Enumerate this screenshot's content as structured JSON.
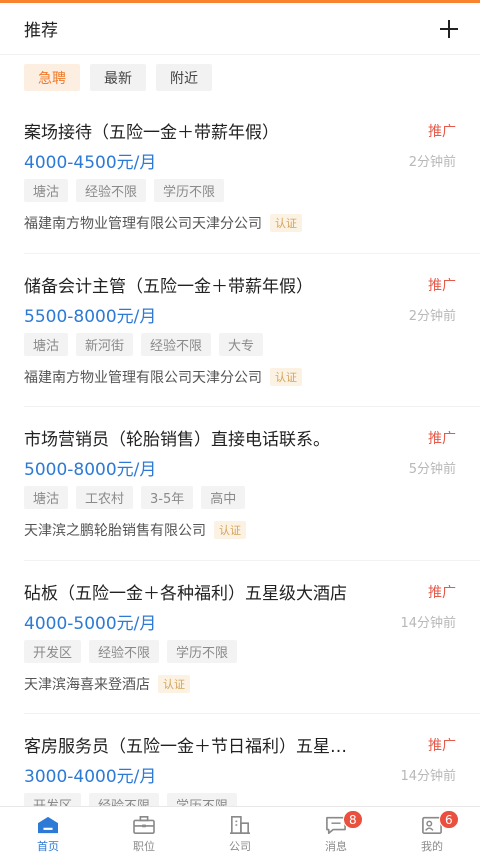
{
  "header": {
    "title": "推荐"
  },
  "filters": [
    {
      "label": "急聘",
      "active": true
    },
    {
      "label": "最新",
      "active": false
    },
    {
      "label": "附近",
      "active": false
    }
  ],
  "jobs": [
    {
      "title": "案场接待（五险一金＋带薪年假）",
      "promo": "推广",
      "salary": "4000-4500元/月",
      "time": "2分钟前",
      "tags": [
        "塘沽",
        "经验不限",
        "学历不限"
      ],
      "company": "福建南方物业管理有限公司天津分公司",
      "verified": "认证"
    },
    {
      "title": "储备会计主管（五险一金＋带薪年假）",
      "promo": "推广",
      "salary": "5500-8000元/月",
      "time": "2分钟前",
      "tags": [
        "塘沽",
        "新河街",
        "经验不限",
        "大专"
      ],
      "company": "福建南方物业管理有限公司天津分公司",
      "verified": "认证"
    },
    {
      "title": "市场营销员（轮胎销售）直接电话联系。",
      "promo": "推广",
      "salary": "5000-8000元/月",
      "time": "5分钟前",
      "tags": [
        "塘沽",
        "工农村",
        "3-5年",
        "高中"
      ],
      "company": "天津滨之鹏轮胎销售有限公司",
      "verified": "认证"
    },
    {
      "title": "砧板（五险一金＋各种福利）五星级大酒店",
      "promo": "推广",
      "salary": "4000-5000元/月",
      "time": "14分钟前",
      "tags": [
        "开发区",
        "经验不限",
        "学历不限"
      ],
      "company": "天津滨海喜来登酒店",
      "verified": "认证"
    },
    {
      "title": "客房服务员（五险一金＋节日福利）五星…",
      "promo": "推广",
      "salary": "3000-4000元/月",
      "time": "14分钟前",
      "tags": [
        "开发区",
        "经验不限",
        "学历不限"
      ],
      "company": "",
      "verified": ""
    }
  ],
  "tabbar": [
    {
      "label": "首页",
      "icon": "home-icon",
      "active": true,
      "badge": ""
    },
    {
      "label": "职位",
      "icon": "briefcase-icon",
      "active": false,
      "badge": ""
    },
    {
      "label": "公司",
      "icon": "building-icon",
      "active": false,
      "badge": ""
    },
    {
      "label": "消息",
      "icon": "message-icon",
      "active": false,
      "badge": "8"
    },
    {
      "label": "我的",
      "icon": "profile-icon",
      "active": false,
      "badge": "6"
    }
  ],
  "colors": {
    "accent": "#f7832f",
    "salary": "#2d7ad6",
    "promo": "#e65a4a",
    "badge": "#e9503e"
  }
}
